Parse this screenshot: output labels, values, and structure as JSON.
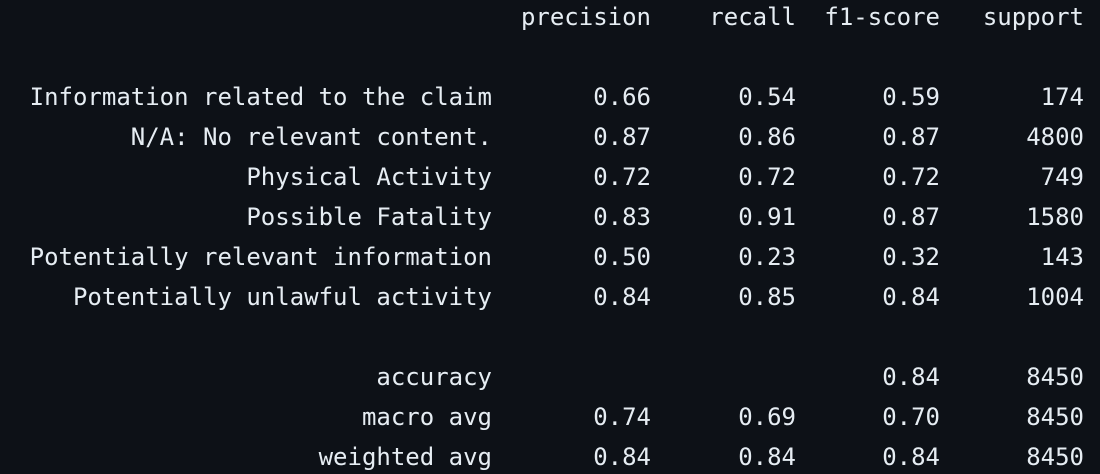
{
  "header": {
    "precision": "precision",
    "recall": "recall",
    "f1": "f1-score",
    "support": "support"
  },
  "classes": [
    {
      "label": "Information related to the claim",
      "precision": "0.66",
      "recall": "0.54",
      "f1": "0.59",
      "support": "174"
    },
    {
      "label": "N/A: No relevant content.",
      "precision": "0.87",
      "recall": "0.86",
      "f1": "0.87",
      "support": "4800"
    },
    {
      "label": "Physical Activity",
      "precision": "0.72",
      "recall": "0.72",
      "f1": "0.72",
      "support": "749"
    },
    {
      "label": "Possible Fatality",
      "precision": "0.83",
      "recall": "0.91",
      "f1": "0.87",
      "support": "1580"
    },
    {
      "label": "Potentially relevant information",
      "precision": "0.50",
      "recall": "0.23",
      "f1": "0.32",
      "support": "143"
    },
    {
      "label": "Potentially unlawful activity",
      "precision": "0.84",
      "recall": "0.85",
      "f1": "0.84",
      "support": "1004"
    }
  ],
  "summary": {
    "accuracy": {
      "label": "accuracy",
      "f1": "0.84",
      "support": "8450"
    },
    "macro": {
      "label": "macro avg",
      "precision": "0.74",
      "recall": "0.69",
      "f1": "0.70",
      "support": "8450"
    },
    "weighted": {
      "label": "weighted avg",
      "precision": "0.84",
      "recall": "0.84",
      "f1": "0.84",
      "support": "8450"
    }
  }
}
